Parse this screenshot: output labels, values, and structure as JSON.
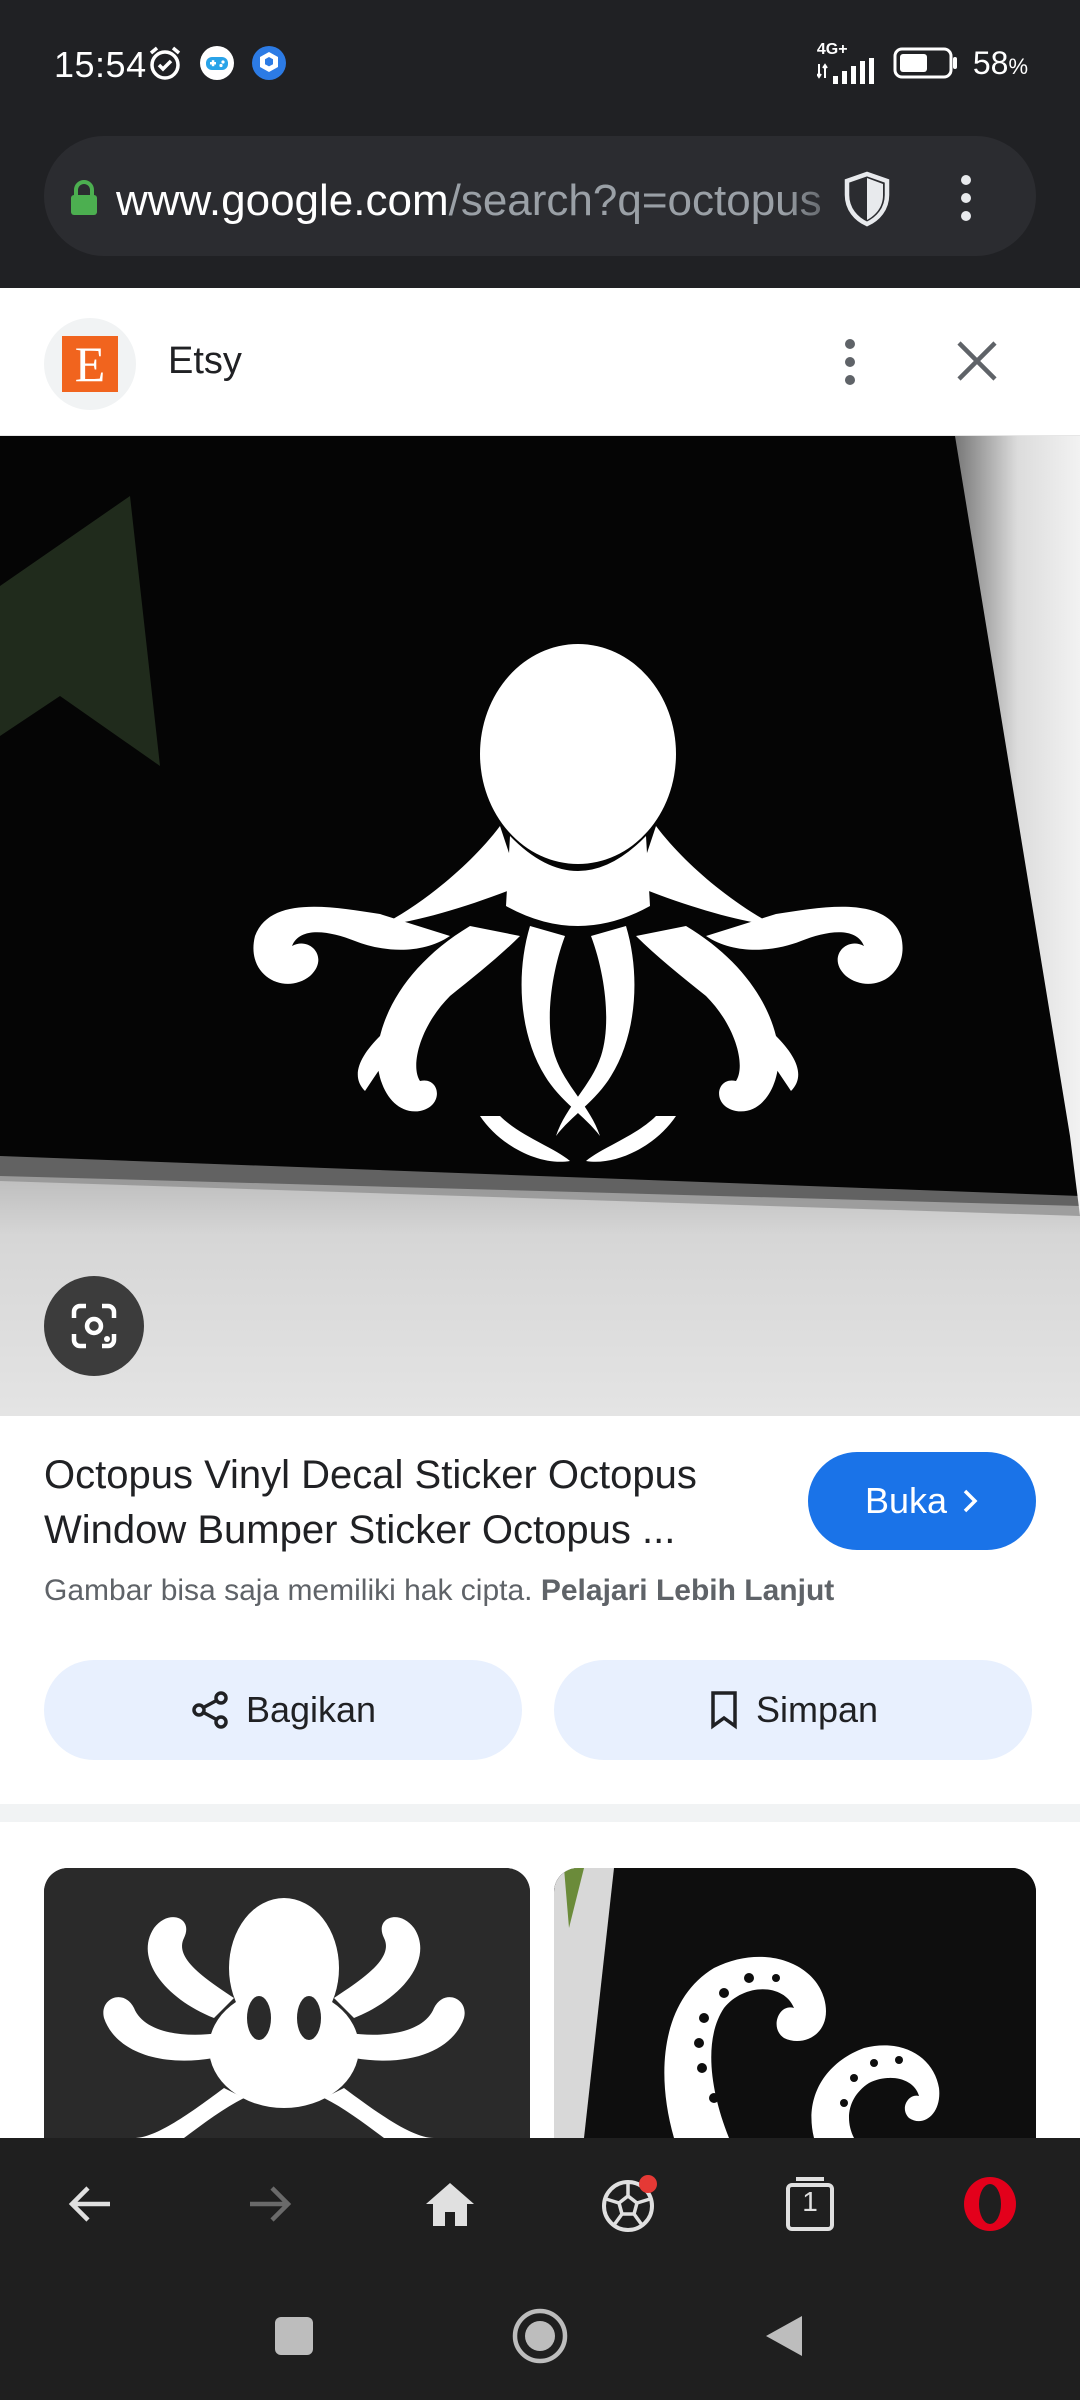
{
  "status_bar": {
    "time": "15:54",
    "network": "4G+",
    "battery_percent": "58",
    "battery_unit": "%",
    "battery_level": 0.58
  },
  "url_bar": {
    "domain": "www.google.com",
    "path": "/search?q=octopus"
  },
  "panel": {
    "site_name": "Etsy",
    "site_logo_letter": "E"
  },
  "result": {
    "title": "Octopus Vinyl Decal Sticker Octopus Window Bumper Sticker Octopus ...",
    "open_label": "Buka",
    "copyright_text": "Gambar bisa saja memiliki hak cipta.",
    "learn_more": "Pelajari Lebih Lanjut",
    "share_label": "Bagikan",
    "save_label": "Simpan"
  },
  "toolbar": {
    "tabs_count": "1",
    "icons": [
      "back-icon",
      "forward-icon",
      "home-icon",
      "football-icon",
      "tabs-icon",
      "opera-icon"
    ]
  },
  "colors": {
    "accent": "#1a73e8",
    "chip_bg": "#e8f0fe",
    "etsy_orange": "#f1641e",
    "notification_dot": "#e53935",
    "opera_red": "#e3001b"
  }
}
